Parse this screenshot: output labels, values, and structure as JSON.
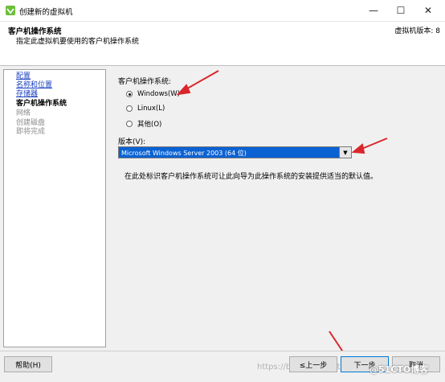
{
  "window": {
    "title": "创建新的虚拟机",
    "minimize_glyph": "—",
    "maximize_glyph": "☐",
    "close_glyph": "✕",
    "app_icon": "vsphere-logo-icon"
  },
  "header": {
    "title": "客户机操作系统",
    "subtitle": "指定此虚拟机要使用的客户机操作系统",
    "version": "虚拟机版本: 8"
  },
  "sidebar": {
    "items": [
      {
        "label": "配置",
        "state": "link"
      },
      {
        "label": "名称和位置",
        "state": "link"
      },
      {
        "label": "存储器",
        "state": "link"
      },
      {
        "label": "客户机操作系统",
        "state": "current"
      },
      {
        "label": "网络",
        "state": "pending"
      },
      {
        "label": "创建磁盘",
        "state": "pending"
      },
      {
        "label": "即将完成",
        "state": "pending"
      }
    ]
  },
  "main": {
    "os_label": "客户机操作系统:",
    "os_options": [
      {
        "label": "Windows(W)",
        "checked": true
      },
      {
        "label": "Linux(L)",
        "checked": false
      },
      {
        "label": "其他(O)",
        "checked": false
      }
    ],
    "version_label": "版本(V):",
    "version_selected": "Microsoft Windows Server 2003 (64 位)",
    "info_text": "在此处标识客户机操作系统可让此向导为此操作系统的安装提供适当的默认值。"
  },
  "footer": {
    "help_label": "帮助(H)",
    "back_label": "≤上一步",
    "next_label": "下一步",
    "cancel_label": "取消",
    "watermark": "https://blog.csdn.net/",
    "watermark2": "@51CTO博客"
  },
  "colors": {
    "link": "#1a3fbf",
    "selection": "#0a62d3",
    "annotation_arrow": "#d9262c"
  }
}
